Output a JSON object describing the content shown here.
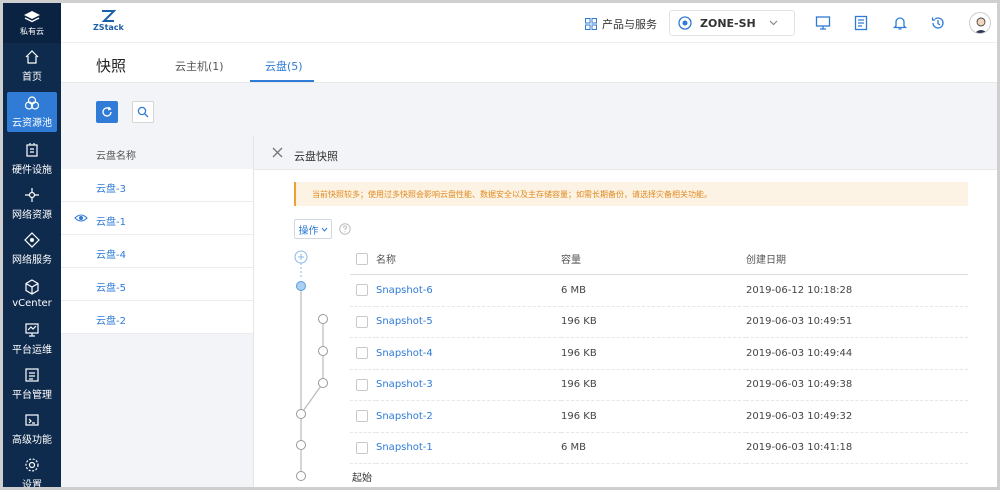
{
  "sidebar": {
    "brand": "私有云",
    "items": [
      {
        "label": "首页",
        "icon": "home-icon",
        "active": false
      },
      {
        "label": "云资源池",
        "icon": "cloud-resource-icon",
        "active": true
      },
      {
        "label": "硬件设施",
        "icon": "hardware-icon",
        "active": false
      },
      {
        "label": "网络资源",
        "icon": "network-icon",
        "active": false
      },
      {
        "label": "网络服务",
        "icon": "network-service-icon",
        "active": false
      },
      {
        "label": "vCenter",
        "icon": "cube-icon",
        "active": false
      },
      {
        "label": "平台运维",
        "icon": "monitor-icon",
        "active": false
      },
      {
        "label": "平台管理",
        "icon": "management-icon",
        "active": false
      },
      {
        "label": "高级功能",
        "icon": "advanced-icon",
        "active": false
      },
      {
        "label": "设置",
        "icon": "gear-icon",
        "active": false
      }
    ]
  },
  "topbar": {
    "logo_text": "ZStack",
    "products_label": "产品与服务",
    "zone": "ZONE-SH"
  },
  "page": {
    "title": "快照",
    "tabs": [
      {
        "label": "云主机(1)",
        "active": false
      },
      {
        "label": "云盘(5)",
        "active": true
      }
    ]
  },
  "disk_list": {
    "header": "云盘名称",
    "rows": [
      {
        "label": "云盘-3",
        "selected": false
      },
      {
        "label": "云盘-1",
        "selected": true
      },
      {
        "label": "云盘-4",
        "selected": false
      },
      {
        "label": "云盘-5",
        "selected": false
      },
      {
        "label": "云盘-2",
        "selected": false
      }
    ]
  },
  "snapshot_panel": {
    "title": "云盘快照",
    "warning": "当前快照较多；使用过多快照会影响云盘性能、数据安全以及主存储容量；如需长期备份，请选择灾备相关功能。",
    "ops_label": "操作",
    "columns": [
      "名称",
      "容量",
      "创建日期"
    ],
    "rows": [
      {
        "name": "Snapshot-6",
        "size": "6 MB",
        "date": "2019-06-12 10:18:28"
      },
      {
        "name": "Snapshot-5",
        "size": "196 KB",
        "date": "2019-06-03 10:49:51"
      },
      {
        "name": "Snapshot-4",
        "size": "196 KB",
        "date": "2019-06-03 10:49:44"
      },
      {
        "name": "Snapshot-3",
        "size": "196 KB",
        "date": "2019-06-03 10:49:38"
      },
      {
        "name": "Snapshot-2",
        "size": "196 KB",
        "date": "2019-06-03 10:49:32"
      },
      {
        "name": "Snapshot-1",
        "size": "6 MB",
        "date": "2019-06-03 10:41:18"
      }
    ],
    "start_label": "起始"
  },
  "colors": {
    "sidebar_bg": "#0e2a4d",
    "accent": "#2f7bd6",
    "warning_text": "#e08a1e",
    "warning_bg": "#fdf3e4"
  }
}
